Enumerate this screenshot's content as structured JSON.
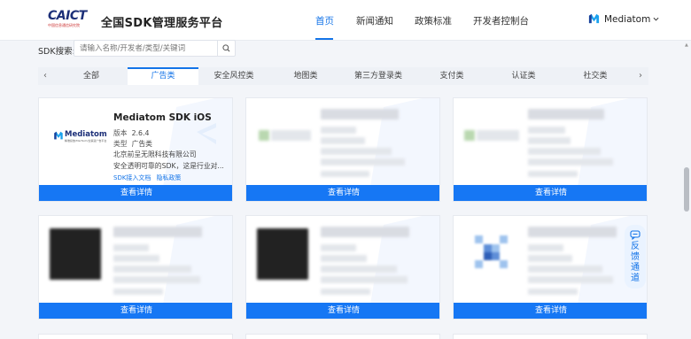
{
  "header": {
    "logo_main": "CAICT",
    "logo_sub": "中国信息通信研究院",
    "site_title": "全国SDK管理服务平台",
    "nav": [
      "首页",
      "新闻通知",
      "政策标准",
      "开发者控制台"
    ],
    "active_nav": "首页",
    "user_name": "Mediatom"
  },
  "search": {
    "label": "SDK搜索:",
    "placeholder": "请输入名称/开发者/类型/关键词"
  },
  "categories": [
    "全部",
    "广告类",
    "安全风控类",
    "地图类",
    "第三方登录类",
    "支付类",
    "认证类",
    "社交类"
  ],
  "active_category": "广告类",
  "featured_card": {
    "name": "Mediatom SDK iOS",
    "logo_text": "Mediatom",
    "logo_sub": "精准投放/MarTech/全渠道广告平台",
    "version_label": "版本",
    "version": "2.6.4",
    "type_label": "类型",
    "type": "广告类",
    "company": "北京前呈无限科技有限公司",
    "description": "安全透明可靠的SDK，这是行业对...",
    "link_docs": "SDK接入文档",
    "link_privacy": "隐私政策",
    "button": "查看详情"
  },
  "cards": [
    {
      "button": "查看详情"
    },
    {
      "button": "查看详情"
    },
    {
      "button": "查看详情"
    },
    {
      "button": "查看详情"
    },
    {
      "button": "查看详情"
    }
  ],
  "feedback": {
    "line1": "反",
    "line2": "馈",
    "line3": "通",
    "line4": "道"
  },
  "colors": {
    "primary": "#1677f4",
    "accent": "#1474e8",
    "brand_navy": "#1c2f78"
  }
}
